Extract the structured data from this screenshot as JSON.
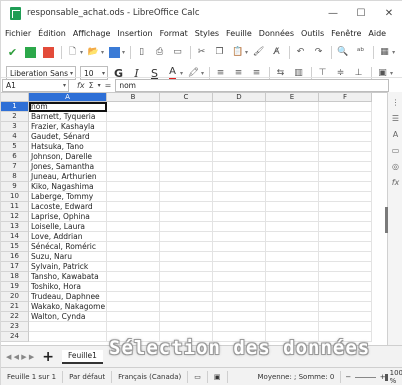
{
  "window": {
    "title": "responsable_achat.ods - LibreOffice Calc",
    "min": "—",
    "max": "☐",
    "close": "✕"
  },
  "menu": [
    "Fichier",
    "Édition",
    "Affichage",
    "Insertion",
    "Format",
    "Styles",
    "Feuille",
    "Données",
    "Outils",
    "Fenêtre",
    "Aide"
  ],
  "toolbar2": {
    "font_name": "Liberation Sans",
    "font_size": "10"
  },
  "formula_bar": {
    "cell_ref": "A1",
    "fx": "fx",
    "sum": "Σ",
    "equals": "=",
    "content": "nom"
  },
  "columns": [
    "A",
    "B",
    "C",
    "D",
    "E",
    "F"
  ],
  "rows": [
    {
      "n": "1",
      "a": "nom"
    },
    {
      "n": "2",
      "a": "Barnett, Tyqueria"
    },
    {
      "n": "3",
      "a": "Frazier, Kashayla"
    },
    {
      "n": "4",
      "a": "Gaudet, Sénard"
    },
    {
      "n": "5",
      "a": "Hatsuka, Tano"
    },
    {
      "n": "6",
      "a": "Johnson, Darelle"
    },
    {
      "n": "7",
      "a": "Jones, Samantha"
    },
    {
      "n": "8",
      "a": "Juneau, Arthurien"
    },
    {
      "n": "9",
      "a": "Kiko, Nagashima"
    },
    {
      "n": "10",
      "a": "Laberge, Tommy"
    },
    {
      "n": "11",
      "a": "Lacoste, Edward"
    },
    {
      "n": "12",
      "a": "Laprise, Ophina"
    },
    {
      "n": "13",
      "a": "Loiselle, Laura"
    },
    {
      "n": "14",
      "a": "Love, Addrian"
    },
    {
      "n": "15",
      "a": "Sénécal, Roméric"
    },
    {
      "n": "16",
      "a": "Suzu, Naru"
    },
    {
      "n": "17",
      "a": "Sylvain, Patrick"
    },
    {
      "n": "18",
      "a": "Tansho, Kawabata"
    },
    {
      "n": "19",
      "a": "Toshiko, Hora"
    },
    {
      "n": "20",
      "a": "Trudeau, Daphnee"
    },
    {
      "n": "21",
      "a": "Wakako, Nakagome"
    },
    {
      "n": "22",
      "a": "Walton, Cynda"
    },
    {
      "n": "23",
      "a": ""
    },
    {
      "n": "24",
      "a": ""
    }
  ],
  "sheet_tabs": {
    "add": "+",
    "active": "Feuille1"
  },
  "status": {
    "sheet": "Feuille 1 sur 1",
    "style": "Par défaut",
    "language": "Français (Canada)",
    "summary": "Moyenne: ; Somme: 0",
    "zoom": "100 %"
  },
  "overlay": "Sélection des données",
  "colors": {
    "selection": "#2e6fd6",
    "accent_green": "#2ca84a"
  }
}
